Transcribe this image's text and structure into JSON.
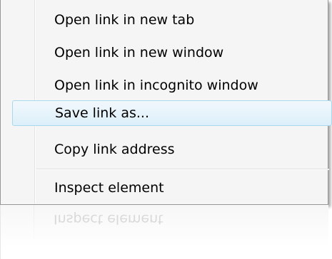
{
  "context_menu": {
    "items": [
      {
        "label": "Open link in new tab"
      },
      {
        "label": "Open link in new window"
      },
      {
        "label": "Open link in incognito window"
      },
      {
        "label": "Save link as..."
      },
      {
        "label": "Copy link address"
      },
      {
        "label": "Inspect element"
      }
    ],
    "highlighted_item": "Save link as...",
    "reflection_label": "Inspect element"
  },
  "colors": {
    "menu_background": "#f5f5f5",
    "highlight_border": "#a8d8eb",
    "highlight_fill": "#dceffa",
    "menu_border": "#979797"
  }
}
